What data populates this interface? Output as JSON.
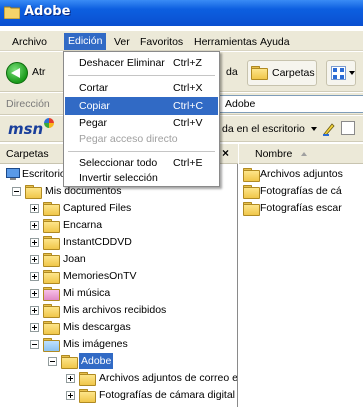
{
  "window": {
    "title": "Adobe"
  },
  "menubar": [
    {
      "label": "Archivo"
    },
    {
      "label": "Edición"
    },
    {
      "label": "Ver"
    },
    {
      "label": "Favoritos"
    },
    {
      "label": "Herramientas"
    },
    {
      "label": "Ayuda"
    }
  ],
  "toolbar": {
    "back_label": "Atr",
    "search_fragment": "da",
    "folders_label": "Carpetas"
  },
  "address": {
    "label": "Dirección",
    "value": "Adobe"
  },
  "msn": {
    "logo": "msn",
    "fragment": "da en el escritorio"
  },
  "folders_pane": {
    "title": "Carpetas",
    "close": "×"
  },
  "tree": [
    {
      "label": "Escritorio",
      "icon": "desktop-icon"
    },
    {
      "label": "Mis documentos",
      "icon": "documents-icon"
    },
    {
      "label": "Captured Files",
      "icon": "folder-icon"
    },
    {
      "label": "Encarna",
      "icon": "folder-icon"
    },
    {
      "label": "InstantCDDVD",
      "icon": "folder-icon"
    },
    {
      "label": "Joan",
      "icon": "folder-icon"
    },
    {
      "label": "MemoriesOnTV",
      "icon": "folder-icon"
    },
    {
      "label": "Mi música",
      "icon": "music-folder-icon"
    },
    {
      "label": "Mis archivos recibidos",
      "icon": "folder-icon"
    },
    {
      "label": "Mis descargas",
      "icon": "folder-icon"
    },
    {
      "label": "Mis imágenes",
      "icon": "pictures-folder-icon"
    },
    {
      "label": "Adobe",
      "icon": "folder-open-icon",
      "selected": true
    },
    {
      "label": "Archivos adjuntos de correo electrónico s",
      "icon": "folder-icon"
    },
    {
      "label": "Fotografías de cámara digital",
      "icon": "folder-icon"
    }
  ],
  "content": {
    "column": "Nombre",
    "files": [
      {
        "label": "Archivos adjuntos"
      },
      {
        "label": "Fotografías de cá"
      },
      {
        "label": "Fotografías escar"
      }
    ]
  },
  "edit_menu": {
    "items": [
      {
        "label": "Deshacer Eliminar",
        "shortcut": "Ctrl+Z"
      },
      {
        "label": "Cortar",
        "shortcut": "Ctrl+X"
      },
      {
        "label": "Copiar",
        "shortcut": "Ctrl+C",
        "highlighted": true
      },
      {
        "label": "Pegar",
        "shortcut": "Ctrl+V"
      },
      {
        "label": "Pegar acceso directo",
        "shortcut": "",
        "disabled": true
      },
      {
        "label": "Seleccionar todo",
        "shortcut": "Ctrl+E"
      },
      {
        "label": "Invertir selección",
        "shortcut": ""
      }
    ]
  },
  "colors": {
    "titlebar": "#0d5fe0",
    "highlight": "#316ac5",
    "chrome": "#ece9d8"
  }
}
